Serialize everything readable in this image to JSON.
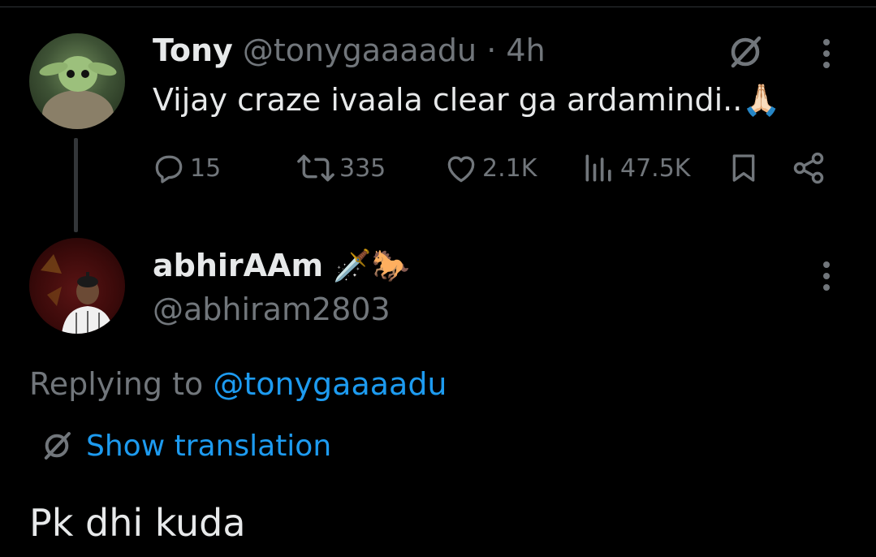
{
  "tweet": {
    "author_name": "Tony",
    "handle": "@tonygaaaadu",
    "separator": "·",
    "time": "4h",
    "text": "Vijay craze ivaala clear ga ardamindi..",
    "emoji": "🙏🏻",
    "replies": "15",
    "retweets": "335",
    "likes": "2.1K",
    "views": "47.5K"
  },
  "reply": {
    "author_name": "abhirAAm",
    "name_emojis": "🗡️🐎",
    "handle": "@abhiram2803",
    "replying_label": "Replying to",
    "replying_handle": "@tonygaaaadu",
    "show_translation": "Show translation",
    "text": "Pk dhi kuda"
  },
  "colors": {
    "background": "#000000",
    "text": "#e7e9ea",
    "muted": "#71767b",
    "link": "#1d9bf0",
    "divider": "#2f3336"
  },
  "icons": [
    "translate-icon",
    "more-icon",
    "reply-icon",
    "retweet-icon",
    "like-icon",
    "views-icon",
    "bookmark-icon",
    "share-icon",
    "avatar"
  ]
}
